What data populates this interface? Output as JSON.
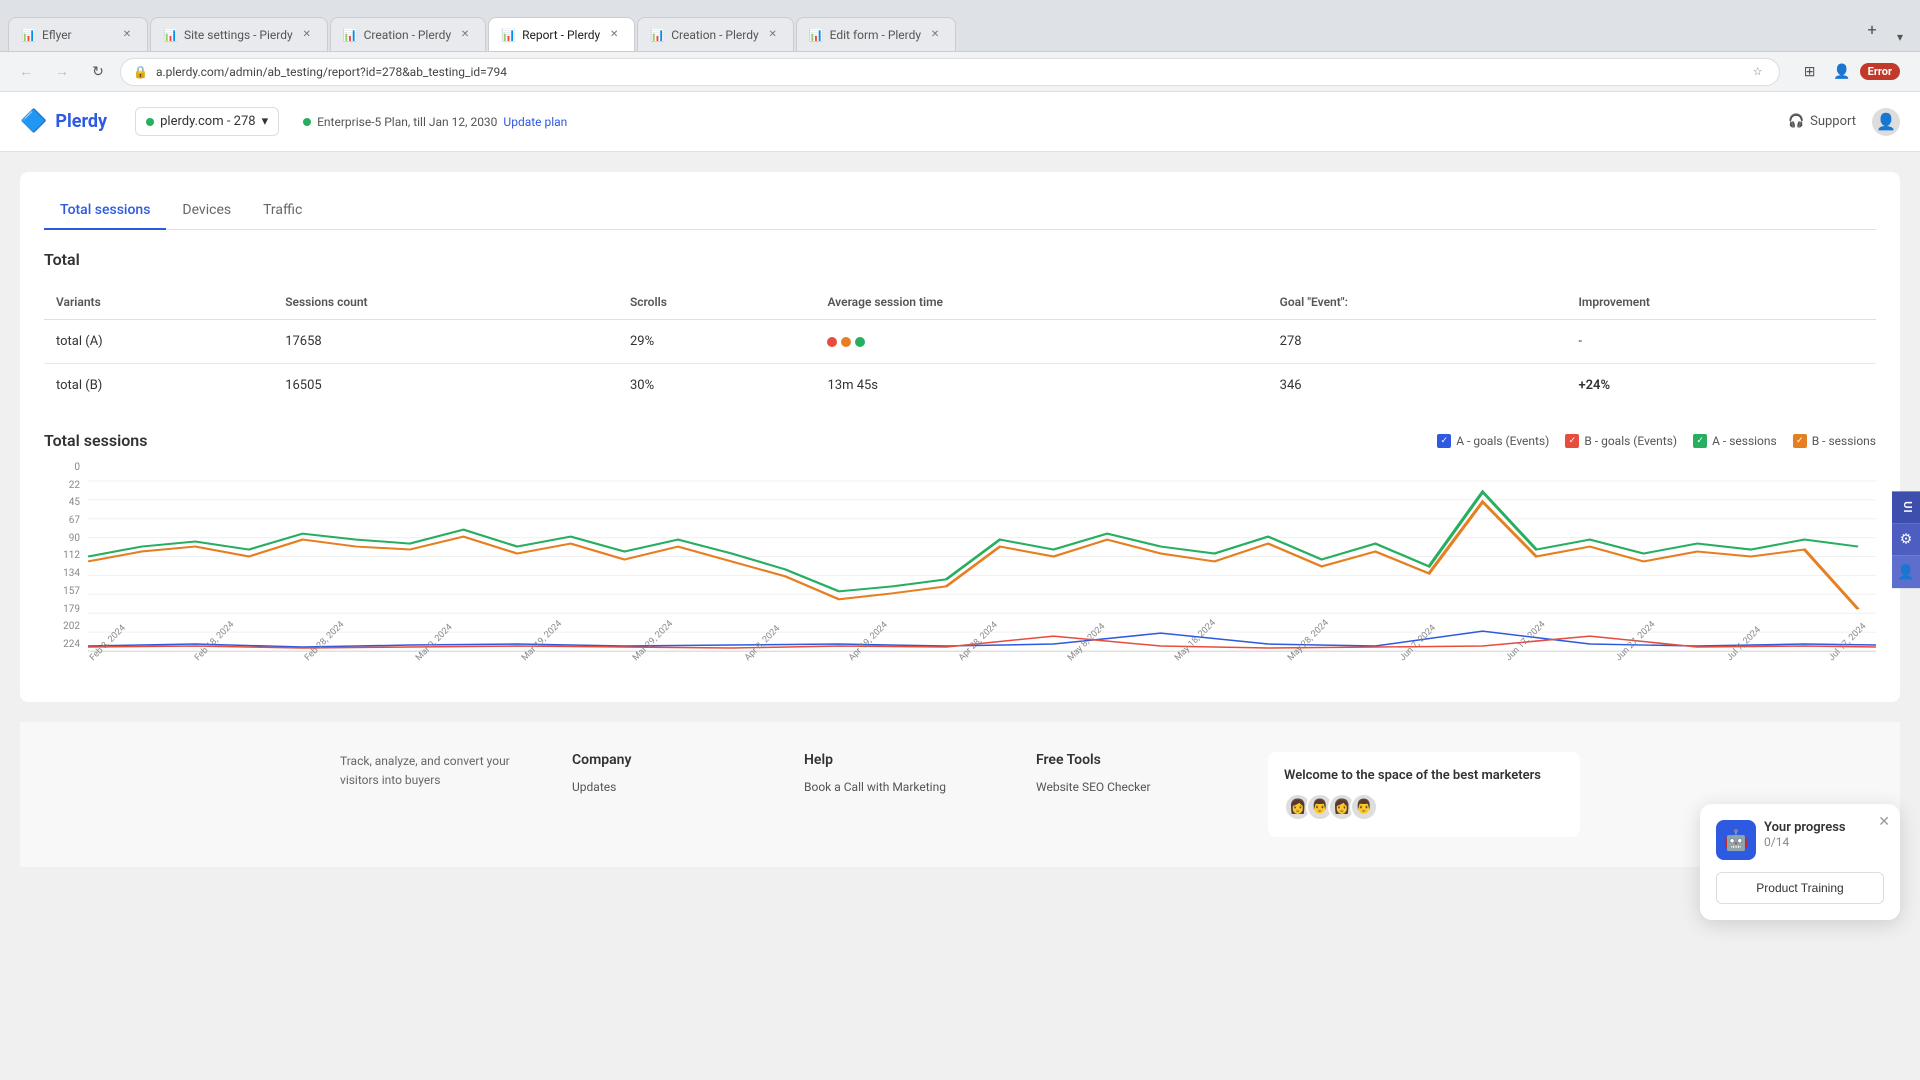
{
  "browser": {
    "tabs": [
      {
        "id": "eflyer",
        "title": "Eflyer",
        "active": false,
        "icon": "🌐"
      },
      {
        "id": "site-settings",
        "title": "Site settings - Pierdy",
        "active": false,
        "icon": "📊"
      },
      {
        "id": "creation",
        "title": "Creation - Plerdy",
        "active": false,
        "icon": "📊"
      },
      {
        "id": "report",
        "title": "Report - Plerdy",
        "active": true,
        "icon": "📊"
      },
      {
        "id": "creation2",
        "title": "Creation - Plerdy",
        "active": false,
        "icon": "📊"
      },
      {
        "id": "edit-form",
        "title": "Edit form - Plerdy",
        "active": false,
        "icon": "📊"
      }
    ],
    "url": "a.plerdy.com/admin/ab_testing/report?id=278&ab_testing_id=794",
    "error_label": "Error"
  },
  "header": {
    "logo_text": "Plerdy",
    "site_selector": "plerdy.com - 278",
    "plan_text": "Enterprise-5 Plan, till Jan 12, 2030",
    "update_plan": "Update plan",
    "support": "Support"
  },
  "report": {
    "tabs": [
      "Total sessions",
      "Devices",
      "Traffic"
    ],
    "active_tab": "Total sessions",
    "section_title": "Total",
    "table": {
      "headers": [
        "Variants",
        "Sessions count",
        "Scrolls",
        "Average session time",
        "Goal \"Event\":",
        "Improvement"
      ],
      "rows": [
        {
          "variant": "total (A)",
          "sessions": "17658",
          "scrolls": "29%",
          "avg_time": "···",
          "goal": "278",
          "improvement": "-"
        },
        {
          "variant": "total (B)",
          "sessions": "16505",
          "scrolls": "30%",
          "avg_time": "13m 45s",
          "goal": "346",
          "improvement": "+24%"
        }
      ]
    },
    "chart": {
      "title": "Total sessions",
      "legend": [
        {
          "label": "A - goals (Events)",
          "color": "#2d5ae0",
          "type": "check"
        },
        {
          "label": "B - goals (Events)",
          "color": "#e74c3c",
          "type": "check"
        },
        {
          "label": "A - sessions",
          "color": "#27ae60",
          "type": "check"
        },
        {
          "label": "B - sessions",
          "color": "#e67e22",
          "type": "check"
        }
      ],
      "y_labels": [
        "224",
        "202",
        "179",
        "157",
        "134",
        "112",
        "90",
        "67",
        "45",
        "22",
        "0"
      ],
      "x_labels": [
        "Feb 8, 2024",
        "Feb 18, 2024",
        "Feb 28, 2024",
        "Mar 9, 2024",
        "Mar 19, 2024",
        "Mar 29, 2024",
        "Apr 8, 2024",
        "Apr 19, 2024",
        "Apr 28, 2024",
        "May 8, 2024",
        "May 18, 2024",
        "May 28, 2024",
        "Jun 7, 2024",
        "Jun 17, 2024",
        "Jun 27, 2024",
        "Jul 7, 2024",
        "Jul 17, 2024"
      ]
    }
  },
  "progress_widget": {
    "title": "Your progress",
    "count": "0/14",
    "button_label": "Product Training"
  },
  "footer": {
    "tagline": "Track, analyze, and convert your visitors into buyers",
    "company": {
      "title": "Company",
      "links": [
        "Updates"
      ]
    },
    "help": {
      "title": "Help",
      "links": [
        "Book a Call with Marketing"
      ]
    },
    "free_tools": {
      "title": "Free Tools",
      "links": [
        "Website SEO Checker"
      ]
    },
    "welcome": {
      "title": "Welcome to the space of the best marketers"
    }
  },
  "right_sidebar": {
    "tabs": [
      "UI",
      "⚙",
      "👤"
    ]
  }
}
